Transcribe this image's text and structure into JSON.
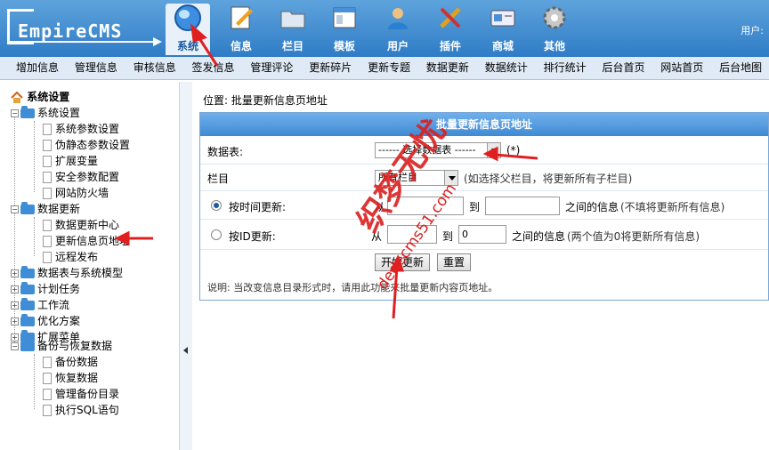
{
  "header": {
    "logo_text": "EmpireCMS",
    "user_label": "用户:",
    "modules": [
      {
        "label": "系统",
        "icon": "globe-icon"
      },
      {
        "label": "信息",
        "icon": "edit-icon"
      },
      {
        "label": "栏目",
        "icon": "folder-icon"
      },
      {
        "label": "模板",
        "icon": "template-icon"
      },
      {
        "label": "用户",
        "icon": "user-icon"
      },
      {
        "label": "插件",
        "icon": "tools-icon"
      },
      {
        "label": "商城",
        "icon": "shop-icon"
      },
      {
        "label": "其他",
        "icon": "gear-icon"
      }
    ]
  },
  "funcbar": [
    "增加信息",
    "管理信息",
    "审核信息",
    "签发信息",
    "管理评论",
    "更新碎片",
    "更新专题",
    "数据更新",
    "数据统计",
    "排行统计",
    "后台首页",
    "网站首页",
    "后台地图"
  ],
  "tree": {
    "root": "系统设置",
    "items": [
      {
        "label": "系统设置",
        "type": "folder",
        "open": true
      },
      {
        "label": "系统参数设置",
        "type": "doc"
      },
      {
        "label": "伪静态参数设置",
        "type": "doc"
      },
      {
        "label": "扩展变量",
        "type": "doc"
      },
      {
        "label": "安全参数配置",
        "type": "doc"
      },
      {
        "label": "网站防火墙",
        "type": "doc"
      },
      {
        "label": "数据更新",
        "type": "folder",
        "open": true
      },
      {
        "label": "数据更新中心",
        "type": "doc"
      },
      {
        "label": "更新信息页地址",
        "type": "doc"
      },
      {
        "label": "远程发布",
        "type": "doc"
      },
      {
        "label": "数据表与系统模型",
        "type": "folder",
        "open": false
      },
      {
        "label": "计划任务",
        "type": "folder",
        "open": false
      },
      {
        "label": "工作流",
        "type": "folder",
        "open": false
      },
      {
        "label": "优化方案",
        "type": "folder",
        "open": false
      },
      {
        "label": "扩展菜单",
        "type": "folder",
        "open": false
      },
      {
        "label": "备份与恢复数据",
        "type": "folder",
        "open": true
      },
      {
        "label": "备份数据",
        "type": "doc"
      },
      {
        "label": "恢复数据",
        "type": "doc"
      },
      {
        "label": "管理备份目录",
        "type": "doc"
      },
      {
        "label": "执行SQL语句",
        "type": "doc"
      }
    ]
  },
  "main": {
    "location": "位置: 批量更新信息页地址",
    "panel_title": "批量更新信息页地址",
    "table_label": "数据表:",
    "table_select": "------ 选择数据表 ------",
    "table_required": "(*)",
    "column_label": "栏目",
    "column_select": "所有栏目",
    "column_hint": "(如选择父栏目，将更新所有子栏目)",
    "by_time_label": "按时间更新:",
    "from_label": "从",
    "to_label": "到",
    "time_range_text": "之间的信息",
    "time_hint": "(不填将更新所有信息)",
    "by_id_label": "按ID更新:",
    "id_from": "",
    "id_to": "0",
    "id_range_text": "之间的信息",
    "id_hint": "(两个值为0将更新所有信息)",
    "start_button": "开始更新",
    "reset_button": "重置",
    "note": "说明: 当改变信息目录形式时，请用此功能来批量更新内容页地址。"
  },
  "watermark": {
    "cn": "织梦无忧",
    "url": "dedecms51.com"
  },
  "colors": {
    "header_blue": "#2f7cc6",
    "arrow_red": "#e02020",
    "panel_border": "#7aa7d8"
  }
}
